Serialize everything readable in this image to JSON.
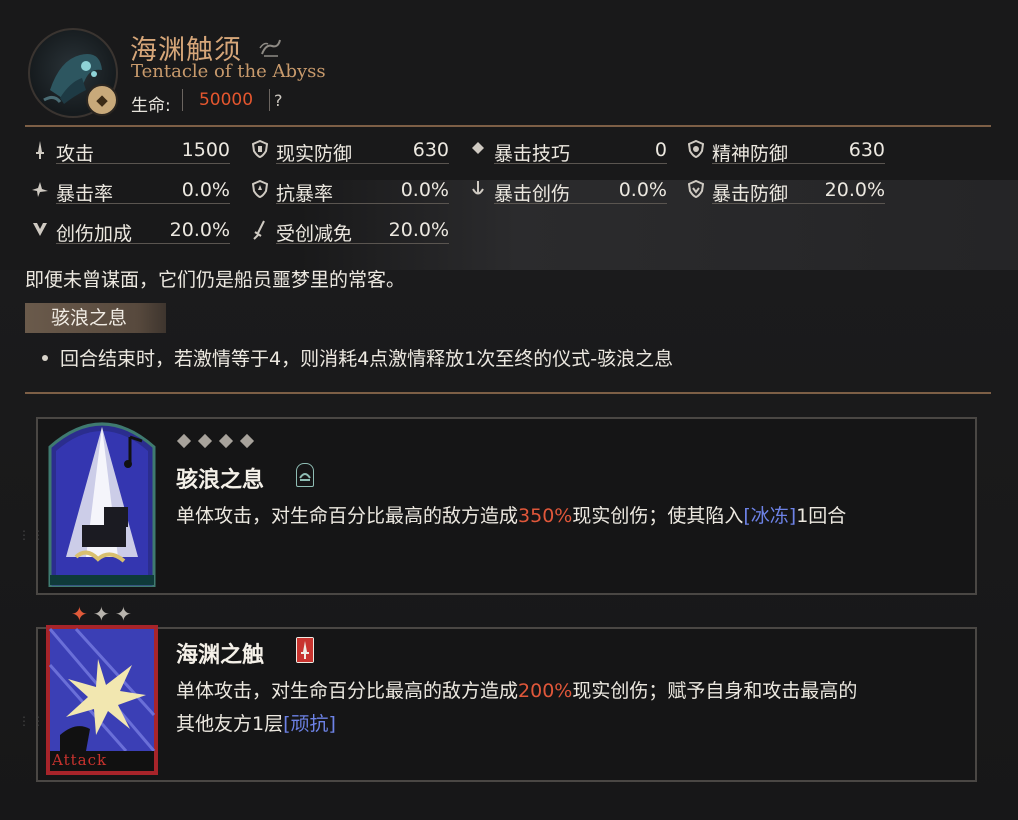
{
  "enemy": {
    "name_zh": "海渊触须",
    "name_en": "Tentacle of the Abyss",
    "hp_label": "生命:",
    "hp_value": "50000",
    "hp_help": "?"
  },
  "stats": [
    {
      "label": "攻击",
      "value": "1500",
      "icon": "sword-icon"
    },
    {
      "label": "现实防御",
      "value": "630",
      "icon": "shield-icon"
    },
    {
      "label": "暴击技巧",
      "value": "0",
      "icon": "diamond-icon"
    },
    {
      "label": "精神防御",
      "value": "630",
      "icon": "mind-shield-icon"
    },
    {
      "label": "暴击率",
      "value": "0.0%",
      "icon": "crit-rate-icon"
    },
    {
      "label": "抗暴率",
      "value": "0.0%",
      "icon": "crit-resist-icon"
    },
    {
      "label": "暴击创伤",
      "value": "0.0%",
      "icon": "crit-damage-icon"
    },
    {
      "label": "暴击防御",
      "value": "20.0%",
      "icon": "crit-defense-icon"
    },
    {
      "label": "创伤加成",
      "value": "20.0%",
      "icon": "damage-bonus-icon"
    },
    {
      "label": "受创减免",
      "value": "20.0%",
      "icon": "damage-reduction-icon"
    }
  ],
  "description": "即便未曾谋面，它们仍是船员噩梦里的常客。",
  "passive": {
    "name": "骇浪之息",
    "text": "回合结束时，若激情等于4，则消耗4点激情释放1次至终的仪式-骇浪之息"
  },
  "skills": [
    {
      "name": "骇浪之息",
      "type_icon": "ritual-icon",
      "text_before": "单体攻击，对生命百分比最高的敌方造成",
      "highlight": "350%",
      "text_after": "现实创伤；使其陷入",
      "link": "[冰冻]",
      "text_end": "1回合"
    },
    {
      "name": "海渊之触",
      "type_icon": "attack-card-icon",
      "art_caption": "Attack",
      "text_before": "单体攻击，对生命百分比最高的敌方造成",
      "highlight": "200%",
      "text_after": "现实创伤；赋予自身和攻击最高的",
      "text_line2": "其他友方1层",
      "link": "[顽抗]"
    }
  ],
  "colors": {
    "accent_gold": "#d6a679",
    "hp_red": "#e4562e",
    "highlight_red": "#e0573a",
    "link_blue": "#6d82e6",
    "divider": "#7d5f46"
  }
}
